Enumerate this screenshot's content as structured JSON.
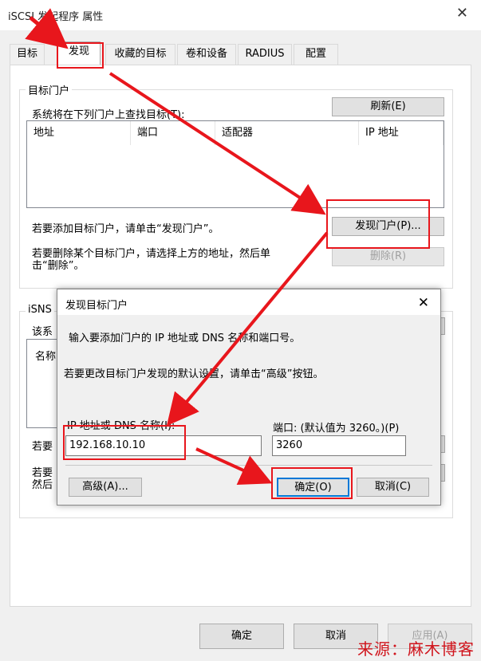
{
  "window": {
    "title": "iSCSI 发起程序 属性",
    "close_glyph": "✕"
  },
  "tabs": [
    "目标",
    "发现",
    "收藏的目标",
    "卷和设备",
    "RADIUS",
    "配置"
  ],
  "target_portals": {
    "legend": "目标门户",
    "description": "系统将在下列门户上查找目标(T):",
    "refresh_button": "刷新(E)",
    "columns": [
      "地址",
      "端口",
      "适配器",
      "IP 地址"
    ],
    "add_hint": "若要添加目标门户，请单击“发现门户”。",
    "discover_button": "发现门户(P)...",
    "remove_hint_line1": "若要删除某个目标门户，请选择上方的地址，然后单",
    "remove_hint_line2": "击“删除”。",
    "remove_button": "删除(R)"
  },
  "isns": {
    "legend": "iSNS",
    "description_fragment": "该系",
    "column_fragment": "名称",
    "add_fragment": "若要",
    "remove_fragment_1": "若要",
    "remove_fragment_2": "然后"
  },
  "dialog": {
    "title": "发现目标门户",
    "close_glyph": "✕",
    "instruction": "输入要添加门户的 IP 地址或 DNS 名称和端口号。",
    "advanced_hint": "若要更改目标门户发现的默认设置，请单击“高级”按钮。",
    "ip_label": "IP 地址或 DNS 名称(I):",
    "ip_value": "192.168.10.10",
    "port_label": "端口: (默认值为 3260。)(P)",
    "port_value": "3260",
    "advanced_button": "高级(A)...",
    "ok_button": "确定(O)",
    "cancel_button": "取消(C)"
  },
  "footer": {
    "ok": "确定",
    "cancel": "取消",
    "apply": "应用(A)"
  },
  "watermark": "来源：麻木博客",
  "colors": {
    "annotation_red": "#e8161c",
    "watermark_red": "#d0141c"
  }
}
